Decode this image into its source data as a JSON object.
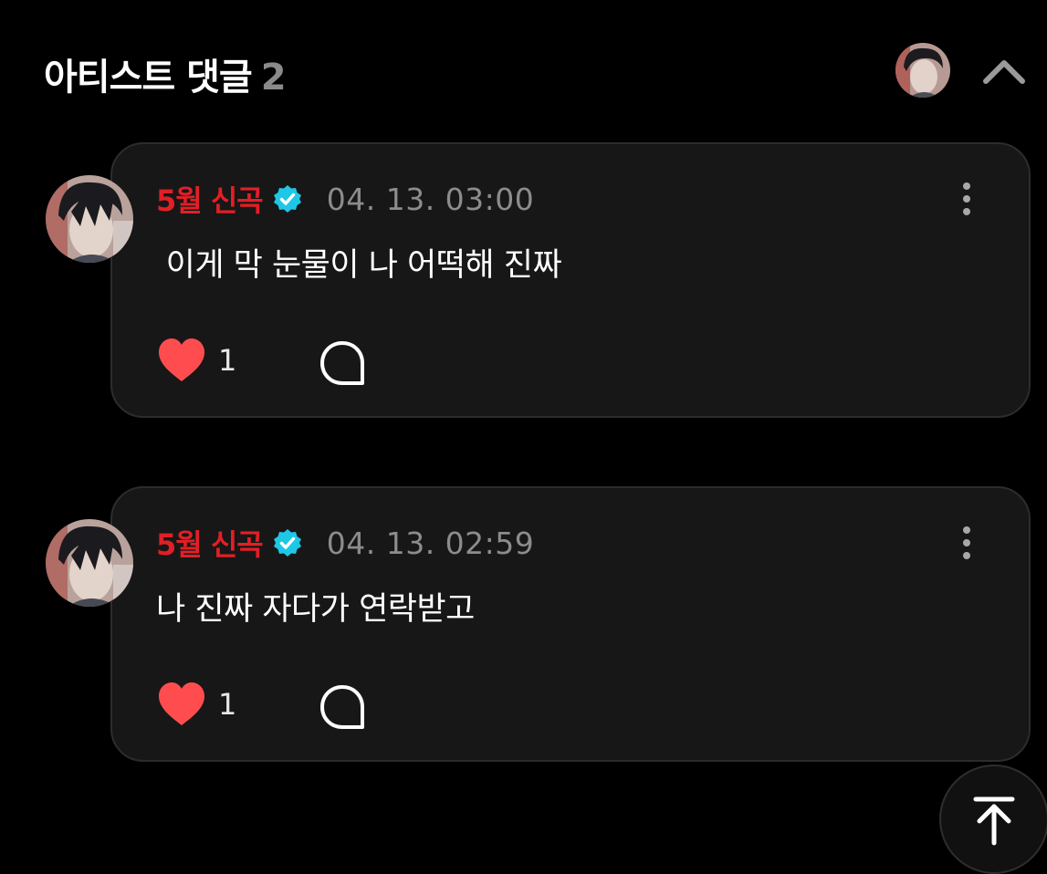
{
  "header": {
    "title": "아티스트 댓글",
    "count": "2"
  },
  "comments": [
    {
      "author": "5월 신곡",
      "timestamp": "04. 13. 03:00",
      "text": " 이게 막 눈물이 나 어떡해 진짜",
      "likes": "1"
    },
    {
      "author": "5월 신곡",
      "timestamp": "04. 13. 02:59",
      "text": "나 진짜 자다가 연락받고",
      "likes": "1"
    }
  ],
  "colors": {
    "background": "#000000",
    "card": "#171717",
    "author_name": "#e21f26",
    "verified_badge": "#1fc7e6",
    "like_heart": "#ff4d4f",
    "timestamp": "#8c8c8c",
    "count": "#8a8a8a"
  },
  "icons": {
    "header_avatar": "artist-avatar",
    "collapse": "chevron-up-icon",
    "verified": "verified-badge-icon",
    "more": "more-vertical-icon",
    "like": "heart-icon",
    "reply": "reply-bubble-icon",
    "scroll_top": "arrow-to-top-icon"
  }
}
